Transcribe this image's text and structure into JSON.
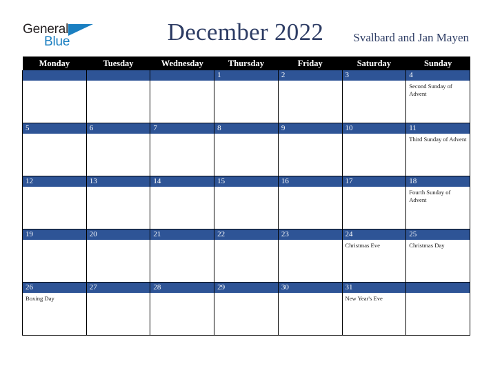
{
  "brand": {
    "name_part1": "General",
    "name_part2": "Blue",
    "triangle_icon": "triangle-icon",
    "accent_color": "#1a7fc1"
  },
  "header": {
    "month_title": "December 2022",
    "locale": "Svalbard and Jan Mayen",
    "title_color": "#2d3c64"
  },
  "calendar": {
    "header_background": "#000000",
    "daynum_background": "#2e5496",
    "weekday_headers": [
      "Monday",
      "Tuesday",
      "Wednesday",
      "Thursday",
      "Friday",
      "Saturday",
      "Sunday"
    ],
    "weeks": [
      [
        {
          "day": "",
          "events": []
        },
        {
          "day": "",
          "events": []
        },
        {
          "day": "",
          "events": []
        },
        {
          "day": "1",
          "events": []
        },
        {
          "day": "2",
          "events": []
        },
        {
          "day": "3",
          "events": []
        },
        {
          "day": "4",
          "events": [
            "Second Sunday of Advent"
          ]
        }
      ],
      [
        {
          "day": "5",
          "events": []
        },
        {
          "day": "6",
          "events": []
        },
        {
          "day": "7",
          "events": []
        },
        {
          "day": "8",
          "events": []
        },
        {
          "day": "9",
          "events": []
        },
        {
          "day": "10",
          "events": []
        },
        {
          "day": "11",
          "events": [
            "Third Sunday of Advent"
          ]
        }
      ],
      [
        {
          "day": "12",
          "events": []
        },
        {
          "day": "13",
          "events": []
        },
        {
          "day": "14",
          "events": []
        },
        {
          "day": "15",
          "events": []
        },
        {
          "day": "16",
          "events": []
        },
        {
          "day": "17",
          "events": []
        },
        {
          "day": "18",
          "events": [
            "Fourth Sunday of Advent"
          ]
        }
      ],
      [
        {
          "day": "19",
          "events": []
        },
        {
          "day": "20",
          "events": []
        },
        {
          "day": "21",
          "events": []
        },
        {
          "day": "22",
          "events": []
        },
        {
          "day": "23",
          "events": []
        },
        {
          "day": "24",
          "events": [
            "Christmas Eve"
          ]
        },
        {
          "day": "25",
          "events": [
            "Christmas Day"
          ]
        }
      ],
      [
        {
          "day": "26",
          "events": [
            "Boxing Day"
          ]
        },
        {
          "day": "27",
          "events": []
        },
        {
          "day": "28",
          "events": []
        },
        {
          "day": "29",
          "events": []
        },
        {
          "day": "30",
          "events": []
        },
        {
          "day": "31",
          "events": [
            "New Year's Eve"
          ]
        },
        {
          "day": "",
          "events": []
        }
      ]
    ]
  }
}
